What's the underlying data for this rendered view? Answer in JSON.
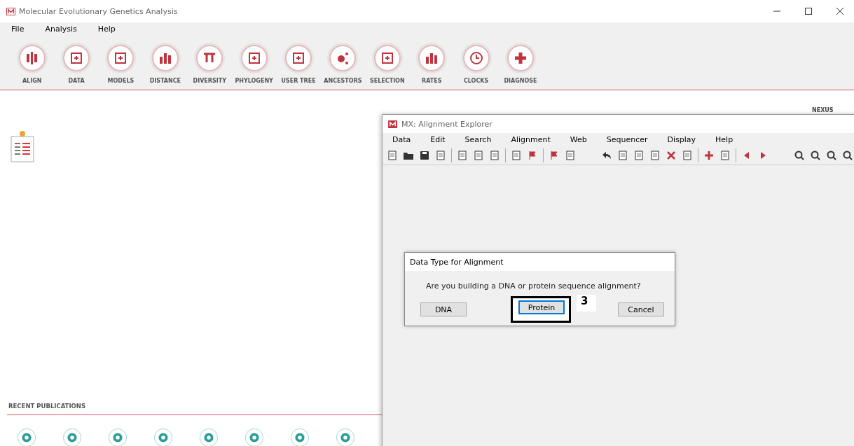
{
  "window": {
    "title": "Molecular Evolutionary Genetics Analysis"
  },
  "menu": [
    "File",
    "Analysis",
    "Help"
  ],
  "toolbar": [
    {
      "label": "ALIGN"
    },
    {
      "label": "DATA"
    },
    {
      "label": "MODELS"
    },
    {
      "label": "DISTANCE"
    },
    {
      "label": "DIVERSITY"
    },
    {
      "label": "PHYLOGENY"
    },
    {
      "label": "USER TREE"
    },
    {
      "label": "ANCESTORS"
    },
    {
      "label": "SELECTION"
    },
    {
      "label": "RATES"
    },
    {
      "label": "CLOCKS"
    },
    {
      "label": "DIAGNOSE"
    }
  ],
  "nexus": "NEXUS",
  "recent": {
    "title": "RECENT PUBLICATIONS"
  },
  "explorer": {
    "title": "MX: Alignment Explorer",
    "menu": [
      "Data",
      "Edit",
      "Search",
      "Alignment",
      "Web",
      "Sequencer",
      "Display",
      "Help"
    ]
  },
  "dialog": {
    "title": "Data Type for Alignment",
    "message": "Are you building a DNA or protein sequence alignment?",
    "buttons": [
      {
        "label": "DNA",
        "focused": false,
        "highlighted": false
      },
      {
        "label": "Protein",
        "focused": true,
        "highlighted": true
      },
      {
        "label": "Cancel",
        "focused": false,
        "highlighted": false
      }
    ],
    "step_label": "3"
  }
}
